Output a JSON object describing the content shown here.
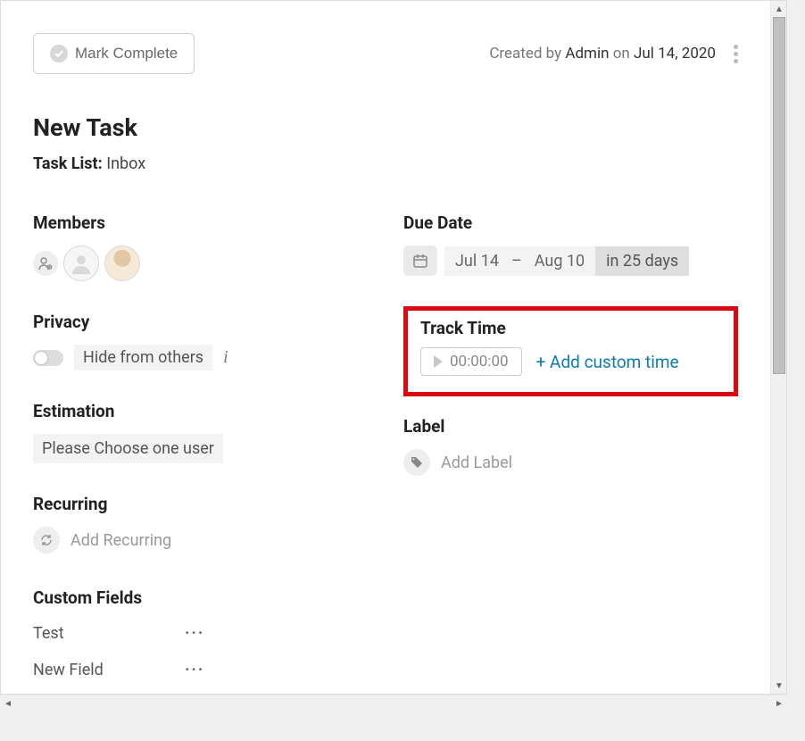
{
  "header": {
    "mark_complete_label": "Mark Complete",
    "created_by_prefix": "Created by",
    "created_by_user": "Admin",
    "created_on_word": "on",
    "created_date": "Jul 14, 2020"
  },
  "task": {
    "title": "New Task",
    "tasklist_label": "Task List:",
    "tasklist_value": "Inbox"
  },
  "members": {
    "title": "Members"
  },
  "privacy": {
    "title": "Privacy",
    "hide_label": "Hide from others"
  },
  "estimation": {
    "title": "Estimation",
    "placeholder": "Please Choose one user"
  },
  "recurring": {
    "title": "Recurring",
    "add_label": "Add Recurring"
  },
  "due_date": {
    "title": "Due Date",
    "start": "Jul 14",
    "dash": "–",
    "end": "Aug 10",
    "remaining": "in 25 days"
  },
  "track_time": {
    "title": "Track Time",
    "timer_value": "00:00:00",
    "add_custom": "+ Add custom time"
  },
  "label": {
    "title": "Label",
    "add_label": "Add Label"
  },
  "custom_fields": {
    "title": "Custom Fields",
    "rows": [
      {
        "name": "Test"
      },
      {
        "name": "New Field"
      }
    ]
  }
}
